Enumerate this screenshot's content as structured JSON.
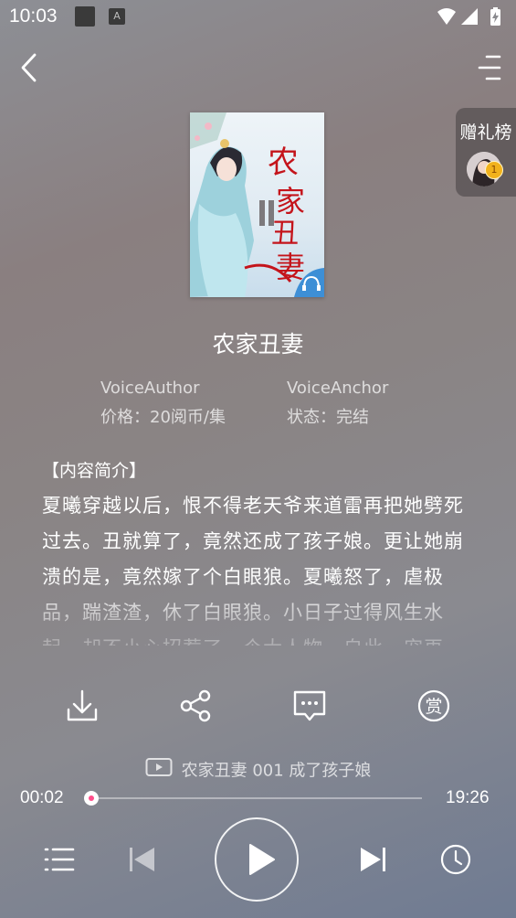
{
  "status_bar": {
    "time": "10:03"
  },
  "gift": {
    "title": "赠礼榜",
    "rank": "1"
  },
  "book": {
    "title": "农家丑妻",
    "author": "VoiceAuthor",
    "anchor": "VoiceAnchor",
    "price": "价格：20阅币/集",
    "status": "状态：完结",
    "cover_title": "农家丑妻"
  },
  "intro": {
    "heading": "【内容简介】",
    "text": "夏曦穿越以后，恨不得老天爷来道雷再把她劈死过去。丑就算了，竟然还成了孩子娘。更让她崩溃的是，竟然嫁了个白眼狼。夏曦怒了，虐极品，踹渣渣，休了白眼狼。小日子过得风生水起，却不小心招惹了一个大人物，自此一宠再"
  },
  "actions": [
    {
      "icon": "download-icon"
    },
    {
      "icon": "share-icon"
    },
    {
      "icon": "comment-icon"
    },
    {
      "icon": "reward-icon",
      "label": "赏"
    }
  ],
  "episode": {
    "label": "农家丑妻 001  成了孩子娘"
  },
  "player": {
    "elapsed": "00:02",
    "duration": "19:26",
    "progress": 0.002,
    "accent": "#ff4f8b"
  }
}
